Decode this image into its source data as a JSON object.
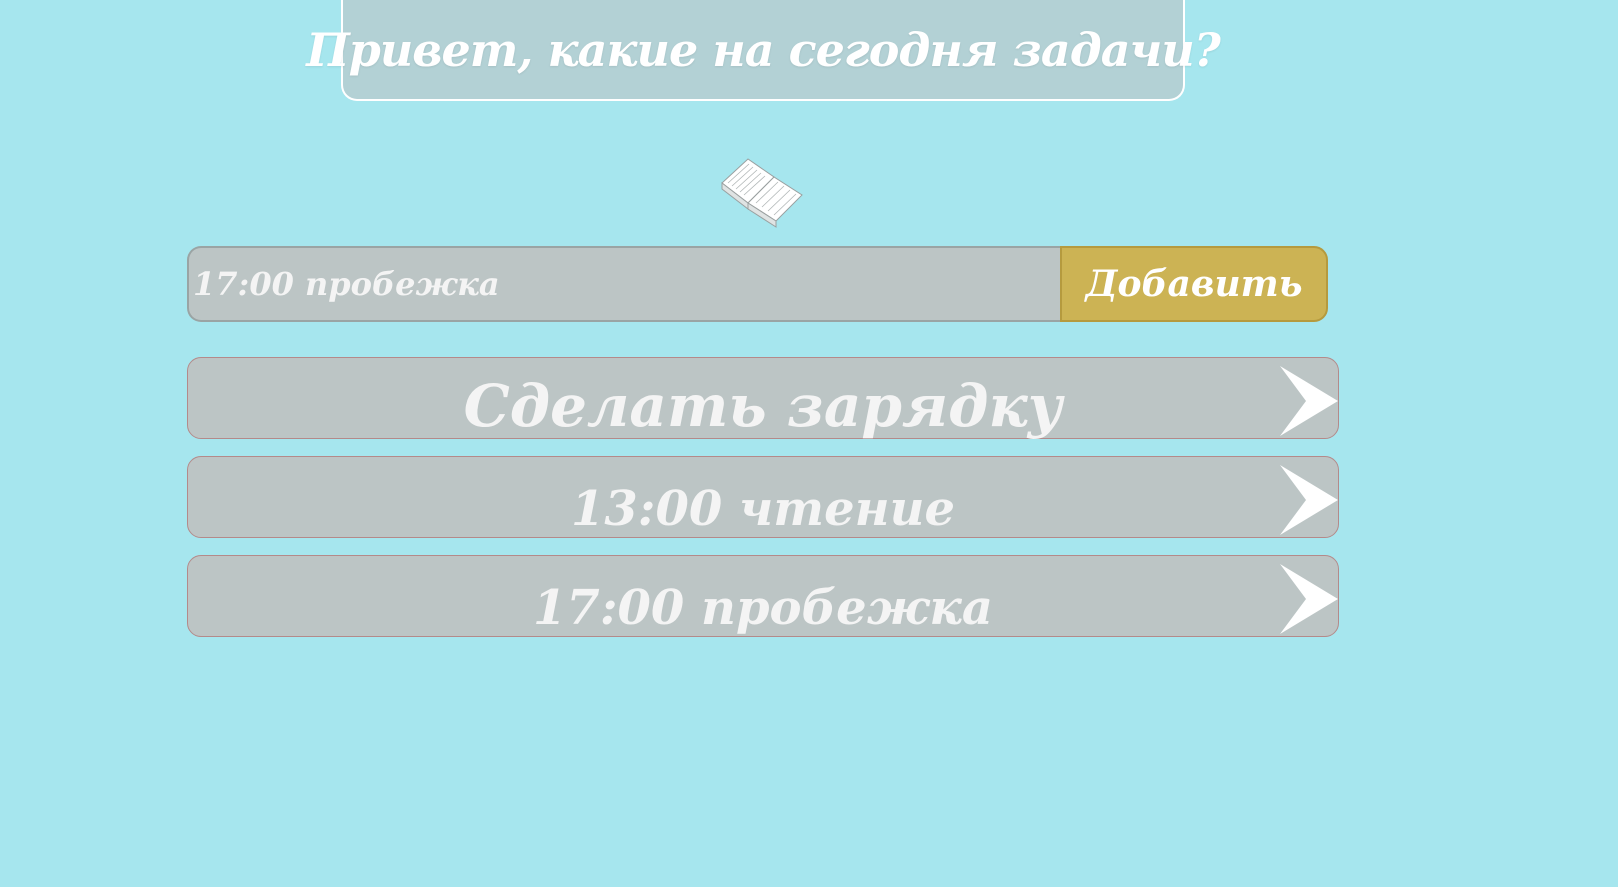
{
  "header": {
    "title": "Привет, какие на сегодня задачи?"
  },
  "icons": {
    "logo": "open-book-icon",
    "task_open": "chevron-right-icon"
  },
  "task_form": {
    "input_value": "17:00 пробежка",
    "add_button_label": "Добавить"
  },
  "tasks": [
    {
      "text": "Сделать зарядку"
    },
    {
      "text": "13:00 чтение"
    },
    {
      "text": "17:00 пробежка"
    }
  ],
  "colors": {
    "background": "#a6e6ee",
    "header_bg": "#b3d1d5",
    "input_bg": "#bcc5c5",
    "button_bg": "#ccb354",
    "text": "#f4f4f4"
  }
}
